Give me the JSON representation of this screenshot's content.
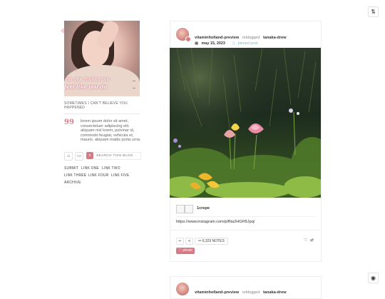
{
  "corner_top": {
    "icon": "shuffle-icon",
    "glyph": "⇅"
  },
  "corner_bottom": {
    "icon": "palette-icon",
    "glyph": "◉"
  },
  "sidebar": {
    "overlay_line1": "no one makes me",
    "overlay_line2": "feel like you do",
    "sparkle_glyph": "✧",
    "description": "SOMETIMES I CAN'T BELIEVE YOU HAPPENED",
    "quote_mark": "99",
    "quote": "lorem ipsum dolor sit amet, consectetuer adipiscing elit. aliquam nisl lorem, pulvinar id, commodo feugiat, vehicula et, mauris. aliquam mattis porta urna.",
    "home_glyph": "⌂",
    "message_glyph": "▭",
    "search_glyph": "⌕",
    "search_placeholder": "SEARCH THIS BLOG",
    "links": [
      "SUBMIT",
      "LINK ONE",
      "LINK TWO",
      "LINK THREE",
      "LINK FOUR",
      "LINK FIVE",
      "ARCHIVE"
    ]
  },
  "post": {
    "username": "vitaminholland-preview",
    "reblogged_text": "reblogged",
    "source_user": "tanaka-drew",
    "date": "may 15, 2023",
    "date_glyph": "▦",
    "pinned_label": "pinned post",
    "pinned_glyph": "▯",
    "caption_user": "1crepe",
    "source_url": "https://www.instagram.com/p/Bia2HGFBJpq/",
    "reply_glyph": "↩",
    "share_glyph": "≺",
    "notes_label": "6,329 NOTES",
    "notes_glyph": "⚯",
    "like_glyph": "♡",
    "reblog_glyph": "⇄",
    "tag": "photo",
    "tag_glyph": "♡"
  },
  "post2": {
    "username": "vitaminholland-preview",
    "reblogged_text": "reblogged",
    "source_user": "tanaka-drew"
  },
  "colors": {
    "accent": "#d47a85",
    "pinned": "#7ab6c9",
    "border": "#eeeeee"
  }
}
